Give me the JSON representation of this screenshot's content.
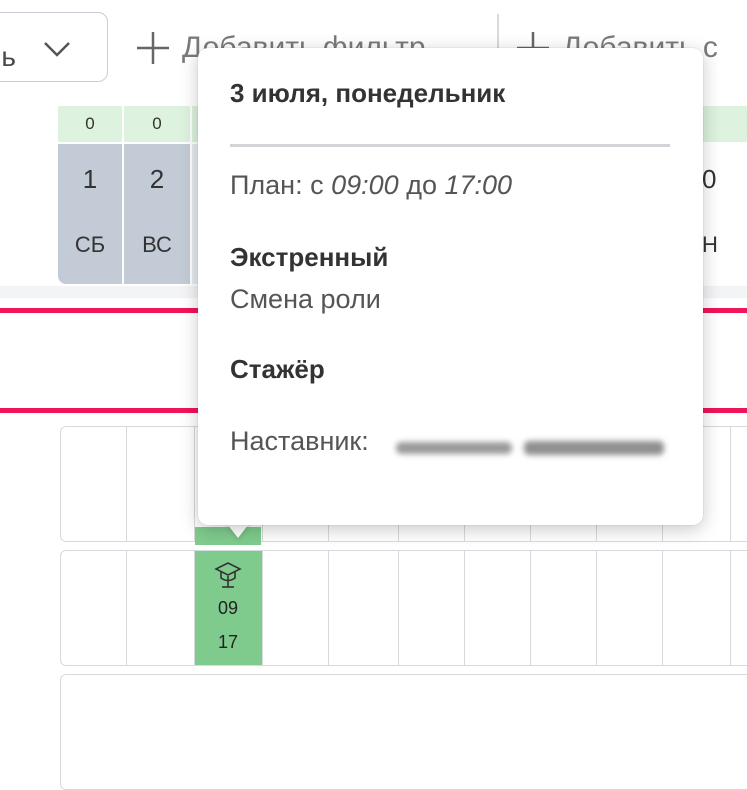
{
  "toolbar": {
    "select_value": "ль",
    "add_filter_label": "Добавить фильтр",
    "add_second_label": "Добавить с"
  },
  "header": {
    "days": [
      {
        "count": "0",
        "num": "1",
        "dow": "СБ"
      },
      {
        "count": "0",
        "num": "2",
        "dow": "ВС"
      }
    ],
    "right_partial": {
      "num": "0",
      "dow": "Н"
    }
  },
  "shift": {
    "start": "09",
    "end": "17"
  },
  "tooltip": {
    "date": "3 июля, понедельник",
    "plan_prefix": "План: с",
    "plan_from": "09:00",
    "plan_mid": "до",
    "plan_to": "17:00",
    "type_title": "Экстренный",
    "type_sub": "Смена роли",
    "role_title": "Стажёр",
    "mentor_label": "Наставник:"
  },
  "colors": {
    "accent_pink": "#f0145a",
    "shift_green": "#7fcb8d",
    "header_green": "#ddf3df",
    "weekend_grey": "#cdd6df"
  }
}
